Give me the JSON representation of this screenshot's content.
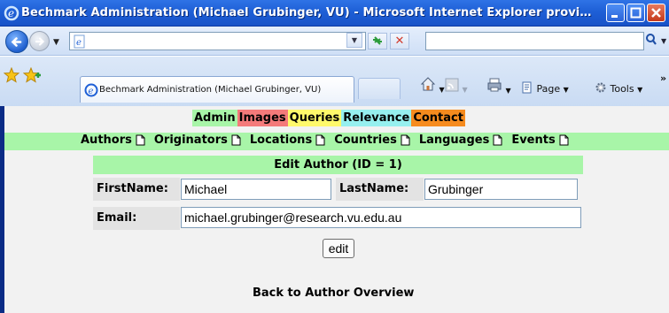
{
  "window": {
    "title": "Bechmark Administration (Michael Grubinger, VU) - Microsoft Internet Explorer provi…"
  },
  "addressbar": {
    "url_value": "",
    "search_value": ""
  },
  "tab": {
    "label": "Bechmark Administration (Michael Grubinger, VU)"
  },
  "commandbar": {
    "page_label": "Page",
    "tools_label": "Tools",
    "more_label": "»"
  },
  "nav": {
    "items": [
      "Admin",
      "Images",
      "Queries",
      "Relevance",
      "Contact"
    ]
  },
  "subnav": {
    "items": [
      "Authors",
      "Originators",
      "Locations",
      "Countries",
      "Languages",
      "Events"
    ]
  },
  "form": {
    "header": "Edit Author (ID = 1)",
    "first_name_label": "FirstName:",
    "first_name_value": "Michael",
    "last_name_label": "LastName:",
    "last_name_value": "Grubinger",
    "email_label": "Email:",
    "email_value": "michael.grubinger@research.vu.edu.au",
    "submit_label": "edit"
  },
  "back_link": "Back to Author Overview",
  "colors": {
    "admin": "#a8f5a8",
    "images": "#f47a7a",
    "queries": "#fff96b",
    "relevance": "#96f0ef",
    "contact": "#f68b1e",
    "subnav": "#a8f5a8",
    "titlebar": "#1e5fd6"
  }
}
